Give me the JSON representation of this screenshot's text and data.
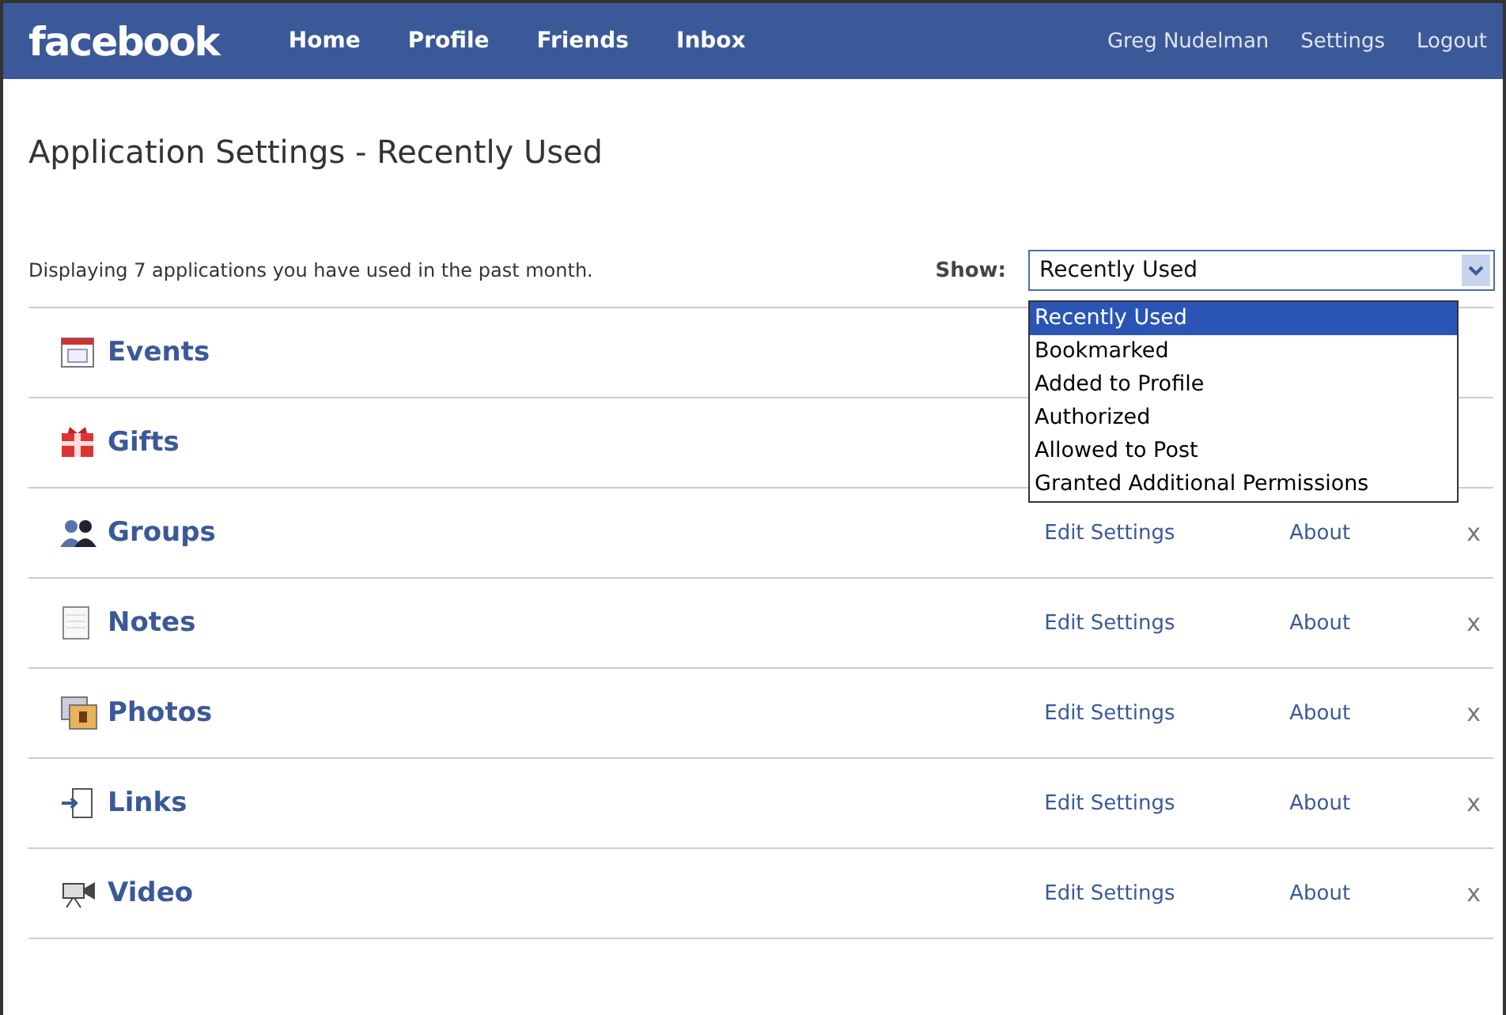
{
  "top_bar": {
    "logo": "facebook",
    "nav": [
      "Home",
      "Profile",
      "Friends",
      "Inbox"
    ],
    "account": [
      "Greg Nudelman",
      "Settings",
      "Logout"
    ]
  },
  "page_title": "Application Settings - Recently Used",
  "summary": "Displaying 7 applications you have used in the past month.",
  "show_filter": {
    "label": "Show:",
    "value": "Recently Used",
    "expanded": true,
    "options": [
      {
        "label": "Recently Used",
        "selected": true
      },
      {
        "label": "Bookmarked",
        "selected": false
      },
      {
        "label": "Added to Profile",
        "selected": false
      },
      {
        "label": "Authorized",
        "selected": false
      },
      {
        "label": "Allowed to Post",
        "selected": false
      },
      {
        "label": "Granted Additional Permissions",
        "selected": false
      }
    ]
  },
  "applications": [
    {
      "name": "Events",
      "kind": "calendar"
    },
    {
      "name": "Gifts",
      "kind": "gift"
    },
    {
      "name": "Groups",
      "kind": "people",
      "edit": "Edit Settings",
      "about": "About",
      "remove": "x"
    },
    {
      "name": "Notes",
      "kind": "note",
      "edit": "Edit Settings",
      "about": "About",
      "remove": "x"
    },
    {
      "name": "Photos",
      "kind": "photo",
      "edit": "Edit Settings",
      "about": "About",
      "remove": "x"
    },
    {
      "name": "Links",
      "kind": "link",
      "edit": "Edit Settings",
      "about": "About",
      "remove": "x"
    },
    {
      "name": "Video",
      "kind": "video",
      "edit": "Edit Settings",
      "about": "About",
      "remove": "x"
    }
  ]
}
